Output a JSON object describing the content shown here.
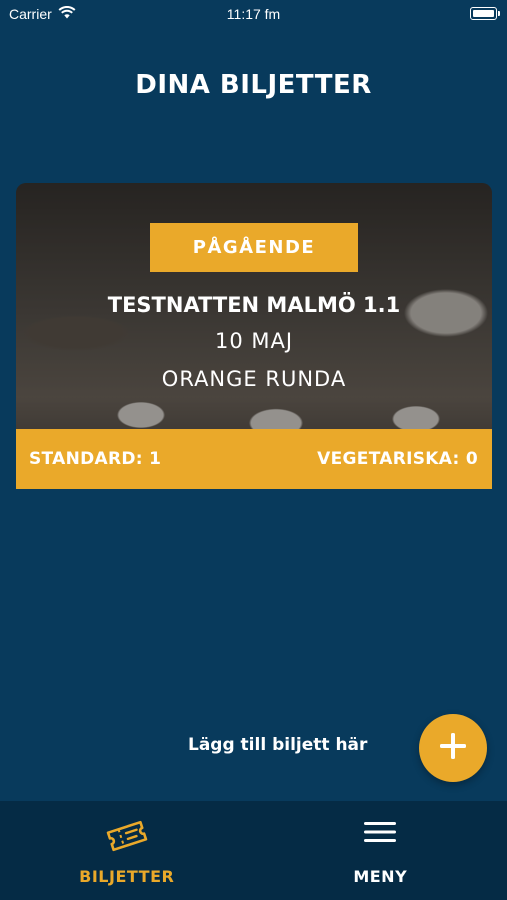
{
  "status_bar": {
    "carrier": "Carrier",
    "time": "11:17 fm"
  },
  "page": {
    "title": "DINA BILJETTER"
  },
  "ticket": {
    "status": "PÅGÅENDE",
    "name": "TESTNATTEN MALMÖ 1.1",
    "date": "10 MAJ",
    "route": "ORANGE RUNDA",
    "standard_label": "STANDARD: 1",
    "vegetarian_label": "VEGETARISKA: 0"
  },
  "add_ticket": {
    "label": "Lägg till biljett här",
    "icon": "plus-icon"
  },
  "tab_bar": {
    "tabs": [
      {
        "label": "BILJETTER",
        "icon": "ticket-icon",
        "active": true
      },
      {
        "label": "MENY",
        "icon": "hamburger-menu-icon",
        "active": false
      }
    ]
  },
  "colors": {
    "background": "#083a5c",
    "accent": "#eaa92a",
    "tab_bar": "#052b45",
    "text": "#ffffff"
  }
}
